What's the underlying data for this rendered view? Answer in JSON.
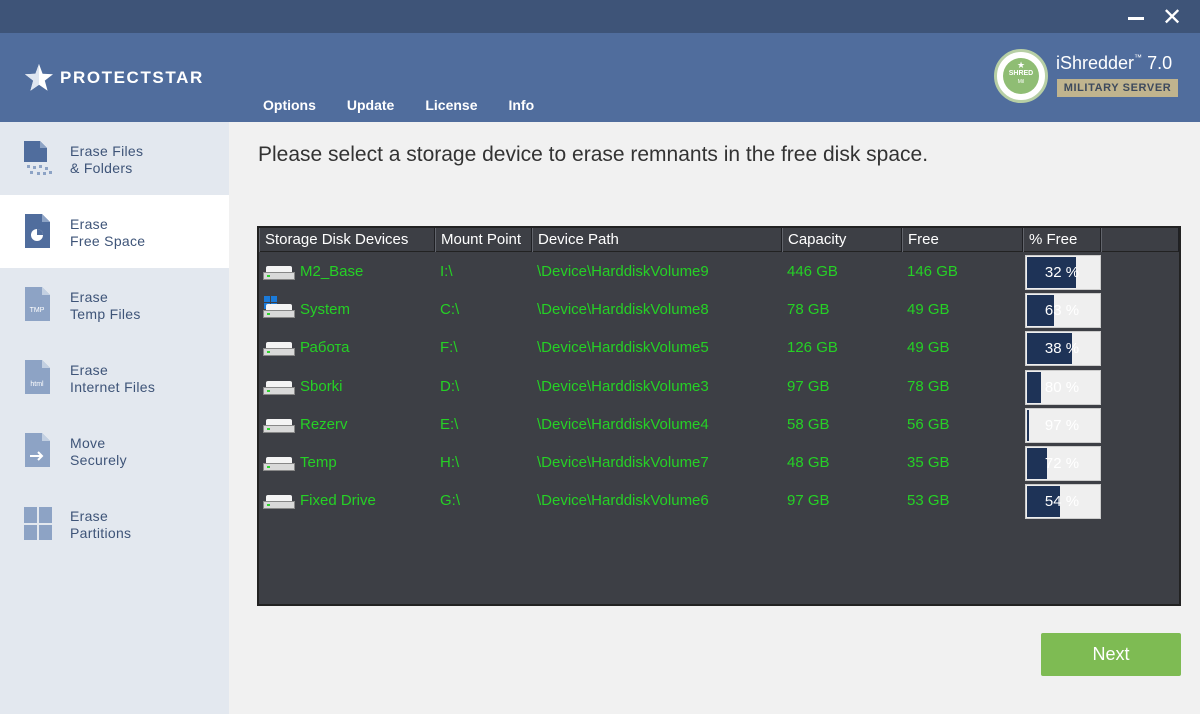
{
  "window": {
    "close_glyph": "✕"
  },
  "brand": {
    "name": "PROTECTSTAR",
    "logo_icon": "star-icon"
  },
  "nav": [
    {
      "label": "Options"
    },
    {
      "label": "Update"
    },
    {
      "label": "License"
    },
    {
      "label": "Info"
    }
  ],
  "product": {
    "name": "iShredder",
    "tm": "™",
    "version": "7.0",
    "edition": "MILITARY SERVER",
    "seal": {
      "top": "★",
      "word": "SHRED",
      "sub": "Mil"
    }
  },
  "sidebar": {
    "items": [
      {
        "line1": "Erase Files",
        "line2": "& Folders",
        "icon": "files-icon",
        "active": false
      },
      {
        "line1": "Erase",
        "line2": "Free Space",
        "icon": "free-space-icon",
        "active": true
      },
      {
        "line1": "Erase",
        "line2": "Temp Files",
        "icon": "temp-file-icon",
        "badge": "TMP",
        "active": false
      },
      {
        "line1": "Erase",
        "line2": "Internet Files",
        "icon": "html-file-icon",
        "badge": "html",
        "active": false
      },
      {
        "line1": "Move",
        "line2": "Securely",
        "icon": "move-file-icon",
        "active": false
      },
      {
        "line1": "Erase",
        "line2": "Partitions",
        "icon": "partitions-icon",
        "active": false
      }
    ]
  },
  "main": {
    "prompt": "Please select a storage device to erase remnants in the free disk space.",
    "table": {
      "columns": [
        "Storage Disk Devices",
        "Mount Point",
        "Device Path",
        "Capacity",
        "Free",
        "% Free"
      ],
      "rows": [
        {
          "name": "M2_Base",
          "mount": "I:\\",
          "path": "\\Device\\HarddiskVolume9",
          "capacity": "446 GB",
          "free": "146 GB",
          "pct_label": "32 %",
          "pct": 32,
          "system": false
        },
        {
          "name": "System",
          "mount": "C:\\",
          "path": "\\Device\\HarddiskVolume8",
          "capacity": "78 GB",
          "free": "49 GB",
          "pct_label": "63 %",
          "pct": 63,
          "system": true
        },
        {
          "name": "Работа",
          "mount": "F:\\",
          "path": "\\Device\\HarddiskVolume5",
          "capacity": "126 GB",
          "free": "49 GB",
          "pct_label": "38 %",
          "pct": 38,
          "system": false
        },
        {
          "name": "Sborki",
          "mount": "D:\\",
          "path": "\\Device\\HarddiskVolume3",
          "capacity": "97 GB",
          "free": "78 GB",
          "pct_label": "80 %",
          "pct": 80,
          "system": false
        },
        {
          "name": "Rezerv",
          "mount": "E:\\",
          "path": "\\Device\\HarddiskVolume4",
          "capacity": "58 GB",
          "free": "56 GB",
          "pct_label": "97 %",
          "pct": 97,
          "system": false
        },
        {
          "name": "Temp",
          "mount": "H:\\",
          "path": "\\Device\\HarddiskVolume7",
          "capacity": "48 GB",
          "free": "35 GB",
          "pct_label": "72 %",
          "pct": 72,
          "system": false
        },
        {
          "name": "Fixed Drive",
          "mount": "G:\\",
          "path": "\\Device\\HarddiskVolume6",
          "capacity": "97 GB",
          "free": "53 GB",
          "pct_label": "54 %",
          "pct": 54,
          "system": false
        }
      ]
    },
    "next_label": "Next"
  },
  "colors": {
    "header": "#506d9d",
    "titlebar": "#3e5478",
    "table_bg": "#3d3f45",
    "cell_text": "#25d125",
    "bar_used": "#1e3357",
    "next_button": "#7ebb53"
  }
}
